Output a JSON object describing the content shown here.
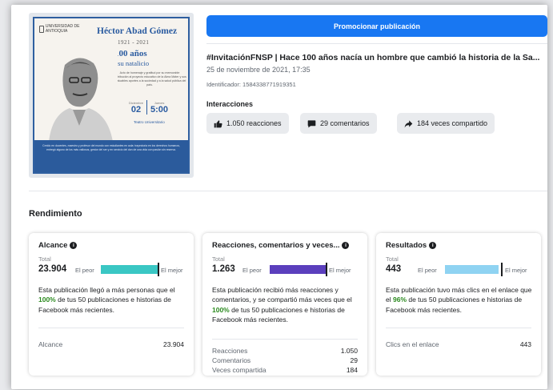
{
  "poster": {
    "university": "UNIVERSIDAD DE ANTIOQUIA",
    "name": "Héctor Abad Gómez",
    "years": "1921 - 2021",
    "headline": "100 años",
    "subheadline": "de su natalicio",
    "blurb": "Acto de homenaje y gratitud por su memorable contribución al proyecto educativo de la Alma Máter y sus invaluables aportes a la sociedad y a la salud pública del país.",
    "date_label_month": "Diciembre",
    "date_label_day": "Jueves",
    "date_day": "02",
    "date_time": "5:00",
    "venue": "Teatro Universitario",
    "footer_text": "Creído en docentes, maestro y profesor del mundo con estudiantes en aula: trayectoria en los derechos humanos, entregó alguno de los más valiosos, gestor del ser y en servicio del don de una vida con pasión sin reserva."
  },
  "header": {
    "promote_button": "Promocionar publicación",
    "post_title": "#InvitaciónFNSP | Hace 100 años nacía un hombre que cambió la historia de la Sa...",
    "post_date": "25 de noviembre de 2021, 17:35",
    "post_id": "Identificador: 1584338771919351",
    "interactions_label": "Interacciones"
  },
  "chips": [
    {
      "label": "1.050 reacciones",
      "icon": "thumbs-up-icon"
    },
    {
      "label": "29 comentarios",
      "icon": "comment-icon"
    },
    {
      "label": "184 veces compartido",
      "icon": "share-icon"
    }
  ],
  "section_title": "Rendimiento",
  "cards": [
    {
      "title": "Alcance",
      "total_label": "Total",
      "total": "23.904",
      "worst_label": "El peor",
      "best_label": "El mejor",
      "bar_color": "#3ac7c4",
      "bar_fraction": 1.0,
      "desc_pre": "Esta publicación llegó a más personas que el ",
      "desc_pct": "100%",
      "desc_post": " de tus 50 publicaciones e historias de Facebook más recientes.",
      "rows": [
        {
          "label": "Alcance",
          "value": "23.904"
        }
      ]
    },
    {
      "title": "Reacciones, comentarios y veces...",
      "total_label": "Total",
      "total": "1.263",
      "worst_label": "El peor",
      "best_label": "El mejor",
      "bar_color": "#5b3fbd",
      "bar_fraction": 1.0,
      "desc_pre": "Esta publicación recibió más reacciones y comentarios, y se compartió más veces que el ",
      "desc_pct": "100%",
      "desc_post": " de tus 50 publicaciones e historias de Facebook más recientes.",
      "rows": [
        {
          "label": "Reacciones",
          "value": "1.050"
        },
        {
          "label": "Comentarios",
          "value": "29"
        },
        {
          "label": "Veces compartida",
          "value": "184"
        }
      ]
    },
    {
      "title": "Resultados",
      "total_label": "Total",
      "total": "443",
      "worst_label": "El peor",
      "best_label": "El mejor",
      "bar_color": "#8fd3f2",
      "bar_fraction": 0.96,
      "desc_pre": "Esta publicación tuvo más clics en el enlace que el ",
      "desc_pct": "96%",
      "desc_post": " de tus 50 publicaciones e historias de Facebook más recientes.",
      "rows": [
        {
          "label": "Clics en el enlace",
          "value": "443"
        }
      ]
    }
  ],
  "colors": {
    "accent": "#1877f2",
    "pct_green": "#2b8a1f",
    "poster_blue": "#2a5ba0"
  }
}
